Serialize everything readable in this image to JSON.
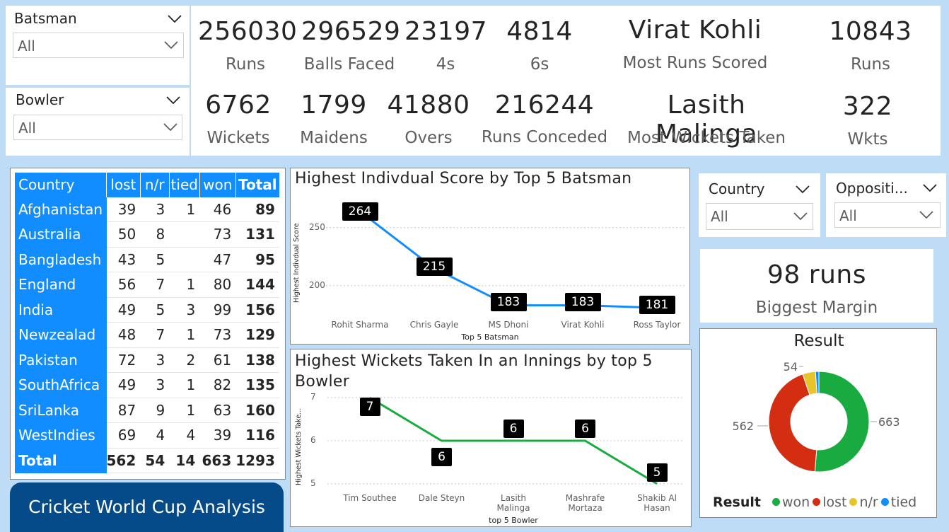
{
  "slicers": {
    "batsman": {
      "title": "Batsman",
      "value": "All"
    },
    "bowler": {
      "title": "Bowler",
      "value": "All"
    },
    "country": {
      "title": "Country",
      "value": "All"
    },
    "opposition": {
      "title": "Oppositi...",
      "value": "All"
    }
  },
  "batting_kpis": [
    {
      "value": "256030",
      "label": "Runs"
    },
    {
      "value": "296529",
      "label": "Balls Faced"
    },
    {
      "value": "23197",
      "label": "4s"
    },
    {
      "value": "4814",
      "label": "6s"
    },
    {
      "value": "Virat Kohli",
      "label": "Most Runs Scored"
    },
    {
      "value": "10843",
      "label": "Runs"
    }
  ],
  "bowling_kpis": [
    {
      "value": "6762",
      "label": "Wickets"
    },
    {
      "value": "1799",
      "label": "Maidens"
    },
    {
      "value": "41880",
      "label": "Overs"
    },
    {
      "value": "216244",
      "label": "Runs Conceded"
    },
    {
      "value": "Lasith Malinga",
      "label": "Most Wickets Taken"
    },
    {
      "value": "322",
      "label": "Wkts"
    }
  ],
  "results_table": {
    "headers": [
      "Country",
      "lost",
      "n/r",
      "tied",
      "won",
      "Total"
    ],
    "rows": [
      [
        "Afghanistan",
        "39",
        "3",
        "1",
        "46",
        "89"
      ],
      [
        "Australia",
        "50",
        "8",
        "",
        "73",
        "131"
      ],
      [
        "Bangladesh",
        "43",
        "5",
        "",
        "47",
        "95"
      ],
      [
        "England",
        "56",
        "7",
        "1",
        "80",
        "144"
      ],
      [
        "India",
        "49",
        "5",
        "3",
        "99",
        "156"
      ],
      [
        "Newzealad",
        "48",
        "7",
        "1",
        "73",
        "129"
      ],
      [
        "Pakistan",
        "72",
        "3",
        "2",
        "61",
        "138"
      ],
      [
        "SouthAfrica",
        "49",
        "3",
        "1",
        "82",
        "135"
      ],
      [
        "SriLanka",
        "87",
        "9",
        "1",
        "63",
        "160"
      ],
      [
        "WestIndies",
        "69",
        "4",
        "4",
        "39",
        "116"
      ]
    ],
    "total": [
      "Total",
      "562",
      "54",
      "14",
      "663",
      "1293"
    ]
  },
  "banner": {
    "text": "Cricket World Cup Analysis"
  },
  "margin_kpi": {
    "value": "98 runs",
    "label": "Biggest Margin"
  },
  "chart_data": [
    {
      "type": "line",
      "title": "Highest Indivdual Score by Top 5 Batsman",
      "xlabel": "Top 5 Batsman",
      "ylabel": "Highest Indivdual Score",
      "categories": [
        "Rohit Sharma",
        "Chris Gayle",
        "MS Dhoni",
        "Virat Kohli",
        "Ross Taylor"
      ],
      "values": [
        264,
        215,
        183,
        183,
        181
      ],
      "ylim": [
        170,
        270
      ],
      "yticks": [
        200,
        250
      ],
      "color": "#118dff"
    },
    {
      "type": "line",
      "title": "Highest Wickets Taken In an Innings by top 5 Bowler",
      "xlabel": "top 5 Bowler",
      "ylabel": "Highest Wickets Take...",
      "categories": [
        "Tim Southee",
        "Dale Steyn",
        "Lasith Malinga",
        "Mashrafe Mortaza",
        "Shakib Al Hasan"
      ],
      "values": [
        7,
        6,
        6,
        6,
        5
      ],
      "ylim": [
        4.8,
        7.2
      ],
      "yticks": [
        5,
        6,
        7
      ],
      "color": "#1aab40"
    },
    {
      "type": "pie",
      "title": "Result",
      "legend_title": "Result",
      "labels": [
        "won",
        "lost",
        "n/r",
        "tied"
      ],
      "values": [
        663,
        562,
        54,
        14
      ],
      "colors": [
        "#1aab40",
        "#d42e12",
        "#e8c42b",
        "#118dff"
      ],
      "legend": "bottom"
    }
  ]
}
